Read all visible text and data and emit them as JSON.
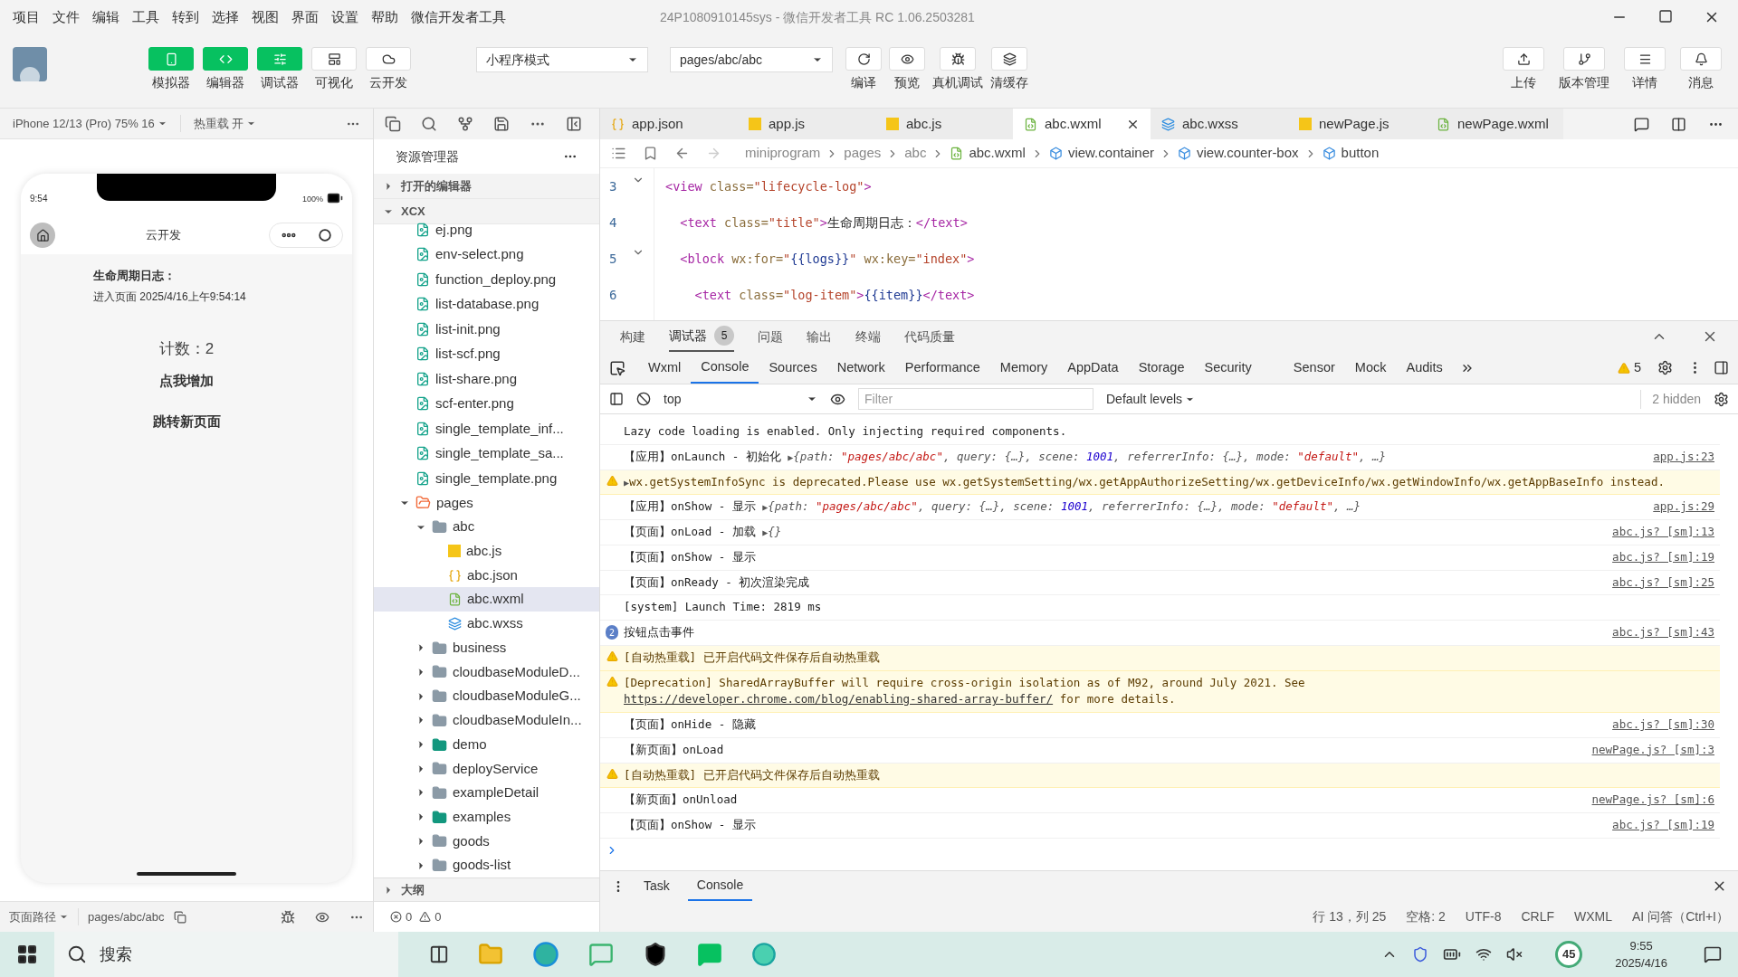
{
  "window": {
    "title": "24P1080910145sys - 微信开发者工具 RC 1.06.2503281"
  },
  "menu": [
    "项目",
    "文件",
    "编辑",
    "工具",
    "转到",
    "选择",
    "视图",
    "界面",
    "设置",
    "帮助",
    "微信开发者工具"
  ],
  "toolbar": {
    "left": [
      {
        "label": "模拟器",
        "selected": true
      },
      {
        "label": "编辑器",
        "selected": true
      },
      {
        "label": "调试器",
        "selected": true
      },
      {
        "label": "可视化",
        "selected": false
      },
      {
        "label": "云开发",
        "selected": false
      }
    ],
    "mode": "小程序模式",
    "page": "pages/abc/abc",
    "actions": [
      "编译",
      "预览",
      "真机调试",
      "清缓存"
    ],
    "right": [
      "上传",
      "版本管理",
      "详情",
      "消息"
    ]
  },
  "simulator": {
    "device": "iPhone 12/13 (Pro) 75% 16",
    "hot_reload": "热重载 开",
    "time": "9:54",
    "battery": "100%",
    "nav_title": "云开发",
    "log_title": "生命周期日志：",
    "log_items": [
      "进入页面 2025/4/16上午9:54:14"
    ],
    "count": "计数：2",
    "buttons": [
      "点我增加",
      "跳转新页面"
    ],
    "path_label": "页面路径",
    "path": "pages/abc/abc"
  },
  "explorer": {
    "title": "资源管理器",
    "sections": [
      {
        "label": "打开的编辑器",
        "expanded": false
      },
      {
        "label": "XCX",
        "expanded": true
      }
    ],
    "files": [
      {
        "name": "ej.png",
        "kind": "image"
      },
      {
        "name": "env-select.png",
        "kind": "image"
      },
      {
        "name": "function_deploy.png",
        "kind": "image"
      },
      {
        "name": "list-database.png",
        "kind": "image"
      },
      {
        "name": "list-init.png",
        "kind": "image"
      },
      {
        "name": "list-scf.png",
        "kind": "image"
      },
      {
        "name": "list-share.png",
        "kind": "image"
      },
      {
        "name": "scf-enter.png",
        "kind": "image"
      },
      {
        "name": "single_template_inf...",
        "kind": "image"
      },
      {
        "name": "single_template_sa...",
        "kind": "image"
      },
      {
        "name": "single_template.png",
        "kind": "image"
      }
    ],
    "tree": [
      {
        "name": "pages",
        "kind": "pages",
        "expanded": true,
        "selected": false,
        "children": [
          {
            "name": "abc",
            "kind": "folder",
            "expanded": true,
            "selected": false,
            "children": [
              {
                "name": "abc.js",
                "kind": "js",
                "selected": false
              },
              {
                "name": "abc.json",
                "kind": "json",
                "selected": false
              },
              {
                "name": "abc.wxml",
                "kind": "wxml",
                "selected": true
              },
              {
                "name": "abc.wxss",
                "kind": "wxss",
                "selected": false
              }
            ]
          },
          {
            "name": "business",
            "kind": "folder",
            "expanded": false,
            "selected": false
          },
          {
            "name": "cloudbaseModuleD...",
            "kind": "folder",
            "expanded": false,
            "selected": false
          },
          {
            "name": "cloudbaseModuleG...",
            "kind": "folder",
            "expanded": false,
            "selected": false
          },
          {
            "name": "cloudbaseModuleIn...",
            "kind": "folder",
            "expanded": false,
            "selected": false
          },
          {
            "name": "demo",
            "kind": "media",
            "expanded": false,
            "selected": false
          },
          {
            "name": "deployService",
            "kind": "folder",
            "expanded": false,
            "selected": false
          },
          {
            "name": "exampleDetail",
            "kind": "folder",
            "expanded": false,
            "selected": false
          },
          {
            "name": "examples",
            "kind": "media",
            "expanded": false,
            "selected": false
          },
          {
            "name": "goods",
            "kind": "folder",
            "expanded": false,
            "selected": false
          },
          {
            "name": "goods-list",
            "kind": "folder",
            "expanded": false,
            "selected": false
          }
        ]
      }
    ],
    "outline": "大纲"
  },
  "editor": {
    "tabs": [
      {
        "label": "app.json",
        "kind": "json",
        "selected": false
      },
      {
        "label": "app.js",
        "kind": "js",
        "selected": false
      },
      {
        "label": "abc.js",
        "kind": "js",
        "selected": false
      },
      {
        "label": "abc.wxml",
        "kind": "wxml",
        "selected": true
      },
      {
        "label": "abc.wxss",
        "kind": "wxss",
        "selected": false
      },
      {
        "label": "newPage.js",
        "kind": "js",
        "selected": false
      },
      {
        "label": "newPage.wxml",
        "kind": "wxml",
        "selected": false
      }
    ],
    "breadcrumb": [
      {
        "label": "miniprogram",
        "kind": "dir"
      },
      {
        "label": "pages",
        "kind": "dir"
      },
      {
        "label": "abc",
        "kind": "dir"
      },
      {
        "label": "abc.wxml",
        "kind": "file"
      },
      {
        "label": "view.container",
        "kind": "node"
      },
      {
        "label": "view.counter-box",
        "kind": "node"
      },
      {
        "label": "button",
        "kind": "node"
      }
    ],
    "lines": [
      {
        "number": "3",
        "fold": true,
        "tokens": [
          {
            "kind": "tag",
            "s": "<view"
          },
          {
            "kind": "attr",
            "s": " class="
          },
          {
            "kind": "str",
            "s": "\"lifecycle-log\""
          },
          {
            "kind": "tag",
            "s": ">"
          }
        ]
      },
      {
        "number": "4",
        "fold": false,
        "tokens": [
          {
            "kind": "tag",
            "s": "  <text"
          },
          {
            "kind": "attr",
            "s": " class="
          },
          {
            "kind": "str",
            "s": "\"title\""
          },
          {
            "kind": "tag",
            "s": ">"
          },
          {
            "kind": "text",
            "s": "生命周期日志："
          },
          {
            "kind": "tag",
            "s": "</text>"
          }
        ]
      },
      {
        "number": "5",
        "fold": true,
        "tokens": [
          {
            "kind": "tag",
            "s": "  <block"
          },
          {
            "kind": "attr",
            "s": " wx:for="
          },
          {
            "kind": "str",
            "s": "\""
          },
          {
            "kind": "expr",
            "s": "{{logs}}"
          },
          {
            "kind": "str",
            "s": "\""
          },
          {
            "kind": "attr",
            "s": " wx:key="
          },
          {
            "kind": "str",
            "s": "\"index\""
          },
          {
            "kind": "tag",
            "s": ">"
          }
        ]
      },
      {
        "number": "6",
        "fold": false,
        "tokens": [
          {
            "kind": "tag",
            "s": "    <text"
          },
          {
            "kind": "attr",
            "s": " class="
          },
          {
            "kind": "str",
            "s": "\"log-item\""
          },
          {
            "kind": "tag",
            "s": ">"
          },
          {
            "kind": "expr",
            "s": "{{item}}"
          },
          {
            "kind": "tag",
            "s": "</text>"
          }
        ]
      }
    ]
  },
  "devtools": {
    "panel_tabs": [
      {
        "label": "构建",
        "selected": false
      },
      {
        "label": "调试器",
        "selected": true,
        "badge": "5"
      },
      {
        "label": "问题",
        "selected": false
      },
      {
        "label": "输出",
        "selected": false
      },
      {
        "label": "终端",
        "selected": false
      },
      {
        "label": "代码质量",
        "selected": false
      }
    ],
    "tabs": [
      {
        "label": "Wxml",
        "selected": false
      },
      {
        "label": "Console",
        "selected": true
      },
      {
        "label": "Sources",
        "selected": false
      },
      {
        "label": "Network",
        "selected": false
      },
      {
        "label": "Performance",
        "selected": false
      },
      {
        "label": "Memory",
        "selected": false
      },
      {
        "label": "AppData",
        "selected": false
      },
      {
        "label": "Storage",
        "selected": false
      },
      {
        "label": "Security",
        "selected": false
      },
      {
        "label": "Sensor",
        "selected": false
      },
      {
        "label": "Mock",
        "selected": false
      },
      {
        "label": "Audits",
        "selected": false
      }
    ],
    "warnings": "5",
    "context": "top",
    "filter_placeholder": "Filter",
    "levels": "Default levels",
    "hidden": "2 hidden",
    "messages": [
      {
        "kind": "log",
        "parts": [
          {
            "kind": "plain",
            "s": "Lazy code loading is enabled. Only injecting required components."
          }
        ]
      },
      {
        "kind": "log",
        "source": "app.js:23",
        "parts": [
          {
            "kind": "plain",
            "s": "【应用】onLaunch - 初始化 "
          },
          {
            "kind": "arrow",
            "s": "▶"
          },
          {
            "kind": "obj",
            "s": "{path: "
          },
          {
            "kind": "str",
            "s": "\"pages/abc/abc\""
          },
          {
            "kind": "obj",
            "s": ", query: {…}, scene: "
          },
          {
            "kind": "num",
            "s": "1001"
          },
          {
            "kind": "obj",
            "s": ", referrerInfo: {…}, mode: "
          },
          {
            "kind": "str",
            "s": "\"default\""
          },
          {
            "kind": "obj",
            "s": ", …}"
          }
        ]
      },
      {
        "kind": "warn",
        "parts": [
          {
            "kind": "arrow",
            "s": "▶"
          },
          {
            "kind": "plain",
            "s": "wx.getSystemInfoSync is deprecated.Please use wx.getSystemSetting/wx.getAppAuthorizeSetting/wx.getDeviceInfo/wx.getWindowInfo/wx.getAppBaseInfo instead."
          }
        ]
      },
      {
        "kind": "log",
        "source": "app.js:29",
        "parts": [
          {
            "kind": "plain",
            "s": "【应用】onShow - 显示 "
          },
          {
            "kind": "arrow",
            "s": "▶"
          },
          {
            "kind": "obj",
            "s": "{path: "
          },
          {
            "kind": "str",
            "s": "\"pages/abc/abc\""
          },
          {
            "kind": "obj",
            "s": ", query: {…}, scene: "
          },
          {
            "kind": "num",
            "s": "1001"
          },
          {
            "kind": "obj",
            "s": ", referrerInfo: {…}, mode: "
          },
          {
            "kind": "str",
            "s": "\"default\""
          },
          {
            "kind": "obj",
            "s": ", …}"
          }
        ]
      },
      {
        "kind": "log",
        "source": "abc.js? [sm]:13",
        "parts": [
          {
            "kind": "plain",
            "s": "【页面】onLoad - 加载 "
          },
          {
            "kind": "arrow",
            "s": "▶"
          },
          {
            "kind": "obj",
            "s": "{}"
          }
        ]
      },
      {
        "kind": "log",
        "source": "abc.js? [sm]:19",
        "parts": [
          {
            "kind": "plain",
            "s": "【页面】onShow - 显示"
          }
        ]
      },
      {
        "kind": "log",
        "source": "abc.js? [sm]:25",
        "parts": [
          {
            "kind": "plain",
            "s": "【页面】onReady - 初次渲染完成"
          }
        ]
      },
      {
        "kind": "log",
        "parts": [
          {
            "kind": "plain",
            "s": "[system] Launch Time: 2819 ms"
          }
        ]
      },
      {
        "kind": "repeat",
        "count": "2",
        "source": "abc.js? [sm]:43",
        "parts": [
          {
            "kind": "plain",
            "s": "按钮点击事件"
          }
        ]
      },
      {
        "kind": "warn",
        "parts": [
          {
            "kind": "plain",
            "s": "[自动热重载] 已开启代码文件保存后自动热重载"
          }
        ]
      },
      {
        "kind": "warn",
        "parts": [
          {
            "kind": "plain",
            "s": "[Deprecation] SharedArrayBuffer will require cross-origin isolation as of M92, around July 2021. See "
          },
          {
            "kind": "link",
            "s": "https://developer.chrome.com/blog/enabling-shared-array-buffer/"
          },
          {
            "kind": "plain",
            "s": " for more details."
          }
        ]
      },
      {
        "kind": "log",
        "source": "abc.js? [sm]:30",
        "parts": [
          {
            "kind": "plain",
            "s": "【页面】onHide - 隐藏"
          }
        ]
      },
      {
        "kind": "log",
        "source": "newPage.js? [sm]:3",
        "parts": [
          {
            "kind": "plain",
            "s": "【新页面】onLoad"
          }
        ]
      },
      {
        "kind": "warn",
        "parts": [
          {
            "kind": "plain",
            "s": "[自动热重载] 已开启代码文件保存后自动热重载"
          }
        ]
      },
      {
        "kind": "log",
        "source": "newPage.js? [sm]:6",
        "parts": [
          {
            "kind": "plain",
            "s": "【新页面】onUnload"
          }
        ]
      },
      {
        "kind": "log",
        "source": "abc.js? [sm]:19",
        "parts": [
          {
            "kind": "plain",
            "s": "【页面】onShow - 显示"
          }
        ]
      }
    ],
    "drawer_tabs": [
      {
        "label": "Task",
        "selected": false
      },
      {
        "label": "Console",
        "selected": true
      }
    ]
  },
  "status_bar": {
    "errors": "0",
    "warnings": "0",
    "items": [
      "行 13，列 25",
      "空格: 2",
      "UTF-8",
      "CRLF",
      "WXML",
      "AI 问答（Ctrl+I）"
    ]
  },
  "taskbar": {
    "search": "搜索",
    "badge": "45",
    "time": "9:55",
    "date": "2025/4/16"
  }
}
